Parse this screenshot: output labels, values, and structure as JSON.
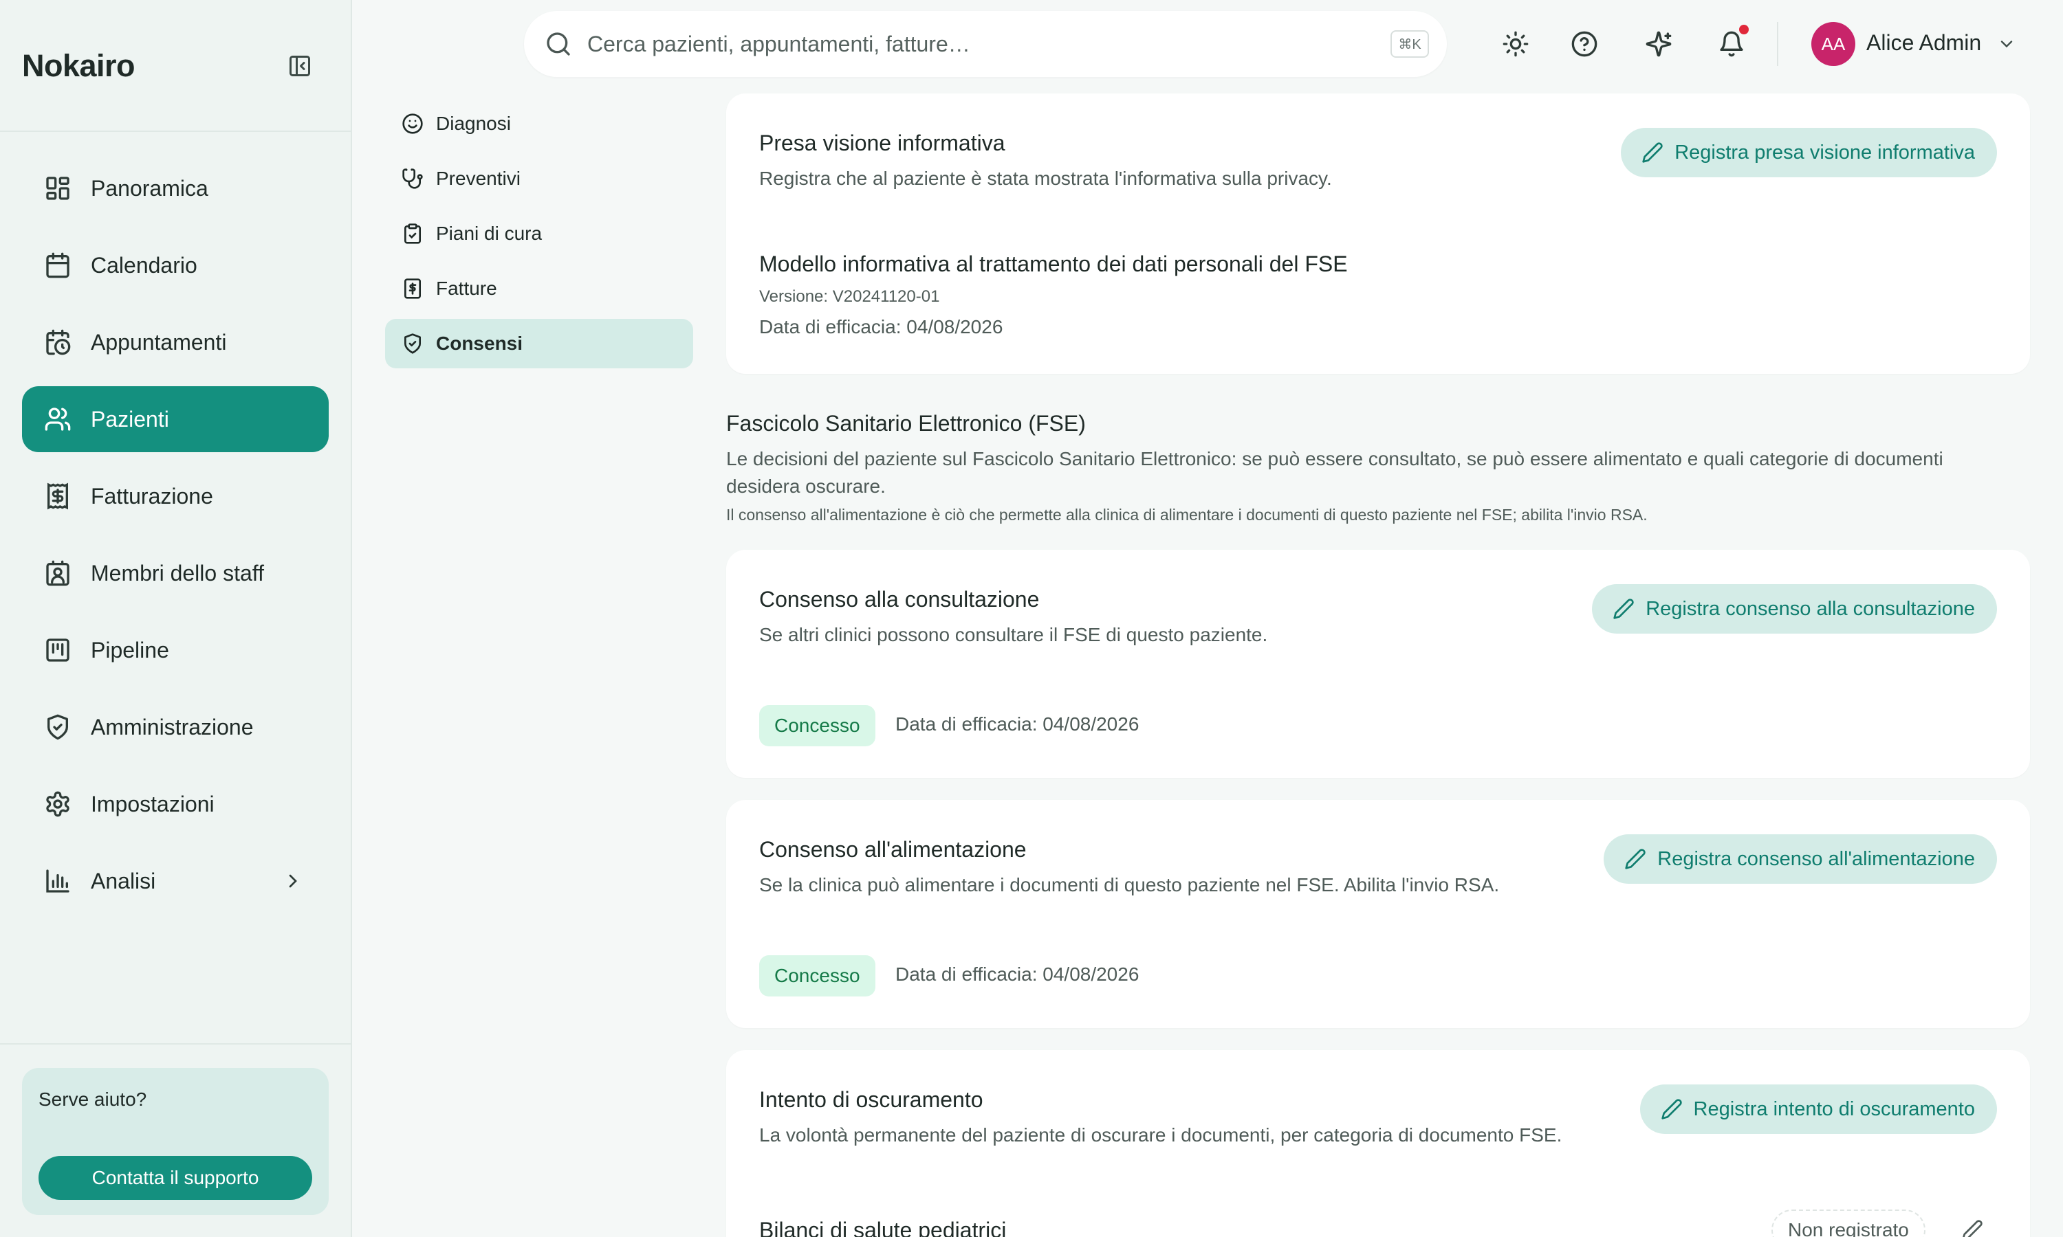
{
  "app": {
    "brand": "Nokairo"
  },
  "sidebar": {
    "items": [
      {
        "label": "Panoramica",
        "icon": "dashboard-icon"
      },
      {
        "label": "Calendario",
        "icon": "calendar-icon"
      },
      {
        "label": "Appuntamenti",
        "icon": "calendar-clock-icon"
      },
      {
        "label": "Pazienti",
        "icon": "users-icon",
        "active": true
      },
      {
        "label": "Fatturazione",
        "icon": "receipt-icon"
      },
      {
        "label": "Membri dello staff",
        "icon": "id-badge-icon"
      },
      {
        "label": "Pipeline",
        "icon": "kanban-icon"
      },
      {
        "label": "Amministrazione",
        "icon": "shield-icon"
      },
      {
        "label": "Impostazioni",
        "icon": "gear-icon"
      },
      {
        "label": "Analisi",
        "icon": "bar-chart-icon"
      }
    ],
    "help": {
      "title": "Serve aiuto?",
      "button": "Contatta il supporto"
    }
  },
  "topbar": {
    "search_placeholder": "Cerca pazienti, appuntamenti, fatture…",
    "shortcut": "⌘K",
    "user": {
      "initials": "AA",
      "name": "Alice Admin"
    }
  },
  "subnav": {
    "items": [
      {
        "label": "Diagnosi",
        "icon": "smile-icon"
      },
      {
        "label": "Preventivi",
        "icon": "stethoscope-icon"
      },
      {
        "label": "Piani di cura",
        "icon": "clipboard-icon"
      },
      {
        "label": "Fatture",
        "icon": "invoice-icon"
      },
      {
        "label": "Consensi",
        "icon": "shield-check-icon",
        "active": true
      }
    ]
  },
  "privacy": {
    "title": "Presa visione informativa",
    "desc": "Registra che al paziente è stata mostrata l'informativa sulla privacy.",
    "button": "Registra presa visione informativa",
    "model_title": "Modello informativa al trattamento dei dati personali del FSE",
    "version": "Versione: V20241120-01",
    "effective": "Data di efficacia: 04/08/2026"
  },
  "fse": {
    "title": "Fascicolo Sanitario Elettronico (FSE)",
    "desc": "Le decisioni del paziente sul Fascicolo Sanitario Elettronico: se può essere consultato, se può essere alimentato e quali categorie di documenti desidera oscurare.",
    "note": "Il consenso all'alimentazione è ciò che permette alla clinica di alimentare i documenti di questo paziente nel FSE; abilita l'invio RSA."
  },
  "consultation": {
    "title": "Consenso alla consultazione",
    "desc": "Se altri clinici possono consultare il FSE di questo paziente.",
    "button": "Registra consenso alla consultazione",
    "status": "Concesso",
    "effective": "Data di efficacia: 04/08/2026"
  },
  "feeding": {
    "title": "Consenso all'alimentazione",
    "desc": "Se la clinica può alimentare i documenti di questo paziente nel FSE. Abilita l'invio RSA.",
    "button": "Registra consenso all'alimentazione",
    "status": "Concesso",
    "effective": "Data di efficacia: 04/08/2026"
  },
  "obscuring": {
    "title": "Intento di oscuramento",
    "desc": "La volontà permanente del paziente di oscurare i documenti, per categoria di documento FSE.",
    "button": "Registra intento di oscuramento",
    "row_label": "Bilanci di salute pediatrici",
    "row_status": "Non registrato"
  },
  "colors": {
    "accent": "#14907f",
    "accent_soft": "#d4ece7",
    "granted_bg": "#d9f7e8",
    "granted_text": "#157a48"
  }
}
